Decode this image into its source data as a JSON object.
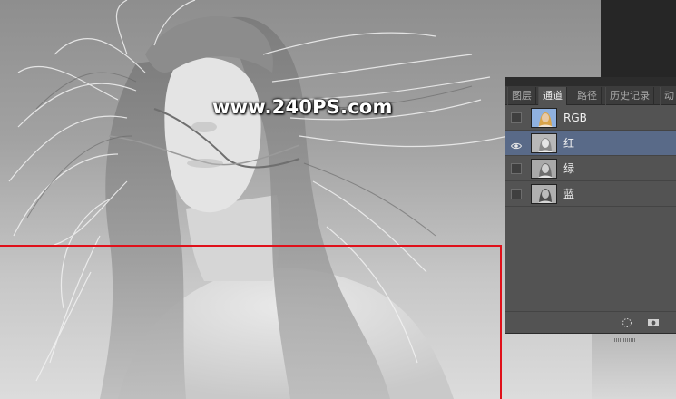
{
  "watermark": {
    "text": "www.240PS.com"
  },
  "selection": {
    "color": "#e0101a"
  },
  "channels_panel": {
    "tabs": [
      {
        "label": "图层",
        "active": false
      },
      {
        "label": "通道",
        "active": true
      },
      {
        "label": "路径",
        "active": false
      },
      {
        "label": "历史记录",
        "active": false
      },
      {
        "label": "动",
        "active": false
      }
    ],
    "channels": [
      {
        "label": "RGB",
        "visible": false,
        "selected": false,
        "thumb": "color"
      },
      {
        "label": "红",
        "visible": true,
        "selected": true,
        "thumb": "gray"
      },
      {
        "label": "绿",
        "visible": false,
        "selected": false,
        "thumb": "gray"
      },
      {
        "label": "蓝",
        "visible": false,
        "selected": false,
        "thumb": "gray-dark"
      }
    ],
    "footer_icons": [
      "load-selection-icon",
      "save-selection-as-channel-icon"
    ],
    "selected_color": "#596a88"
  }
}
